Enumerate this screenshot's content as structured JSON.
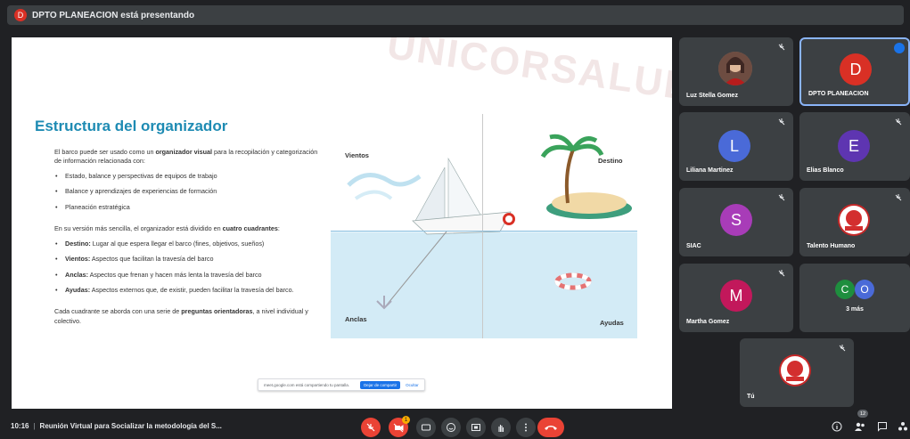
{
  "presenter_bar": {
    "avatar_letter": "D",
    "text": "DPTO PLANEACION está presentando"
  },
  "slide": {
    "watermark": "UNICORSALUD",
    "title": "Estructura del organizador",
    "intro_pre": "El barco puede ser usado como un ",
    "intro_bold": "organizador visual",
    "intro_post": " para la recopilación y categorización de información relacionada con:",
    "bullets1": [
      "Estado, balance y perspectivas de equipos de trabajo",
      "Balance y aprendizajes de experiencias de formación",
      "Planeación estratégica"
    ],
    "para2_pre": "En su versión más sencilla, el organizador está dividido en ",
    "para2_bold": "cuatro cuadrantes",
    "para2_post": ":",
    "bullets2": [
      {
        "term": "Destino:",
        "text": " Lugar al que espera llegar el barco (fines, objetivos, sueños)"
      },
      {
        "term": "Vientos:",
        "text": " Aspectos que facilitan la travesía del barco"
      },
      {
        "term": "Anclas:",
        "text": " Aspectos que frenan y hacen más lenta la travesía del barco"
      },
      {
        "term": "Ayudas:",
        "text": " Aspectos externos que, de existir, pueden facilitar la travesía del barco."
      }
    ],
    "para3_pre": "Cada cuadrante se aborda con una serie de ",
    "para3_bold": "preguntas orientadoras",
    "para3_post": ", a nivel individual y colectivo.",
    "diagram": {
      "vientos": "Vientos",
      "destino": "Destino",
      "anclas": "Anclas",
      "ayudas": "Ayudas"
    },
    "share_notice": {
      "text": "meet.google.com está compartiendo tu pantalla.",
      "stop_label": "Dejar de compartir",
      "hide_label": "Ocultar"
    }
  },
  "participants": [
    {
      "name": "Luz Stella Gomez",
      "avatar": "photo"
    },
    {
      "name": "DPTO PLANEACION",
      "avatar_letter": "D",
      "avatar_color": "#d93025"
    },
    {
      "name": "Liliana Martinez",
      "avatar_letter": "L",
      "avatar_color": "#4a6ad8"
    },
    {
      "name": "Elias Blanco",
      "avatar_letter": "E",
      "avatar_color": "#5e35b1"
    },
    {
      "name": "SIAC",
      "avatar_letter": "S",
      "avatar_color": "#a83cb8"
    },
    {
      "name": "Talento Humano",
      "avatar": "logo"
    },
    {
      "name": "Martha Gomez",
      "avatar_letter": "M",
      "avatar_color": "#c2185b"
    },
    {
      "name": "3 más",
      "avatar_letters": [
        "C",
        "O"
      ]
    },
    {
      "name": "Tú",
      "avatar": "logo"
    }
  ],
  "bottom": {
    "time": "10:16",
    "meeting_title": "Reunión Virtual para Socializar la metodología del S...",
    "people_count": "12",
    "raise_hand_badge": "1"
  },
  "colors": {
    "accent": "#1a73e8",
    "danger": "#ea4335",
    "tile_bg": "#3c4043",
    "bg": "#202124",
    "slide_title": "#1e8bb3"
  },
  "icons": [
    "mic-off-icon",
    "camera-off-icon",
    "captions-icon",
    "emoji-icon",
    "present-icon",
    "raise-hand-icon",
    "more-icon",
    "hang-up-icon",
    "info-icon",
    "people-icon",
    "chat-icon",
    "activities-icon"
  ]
}
